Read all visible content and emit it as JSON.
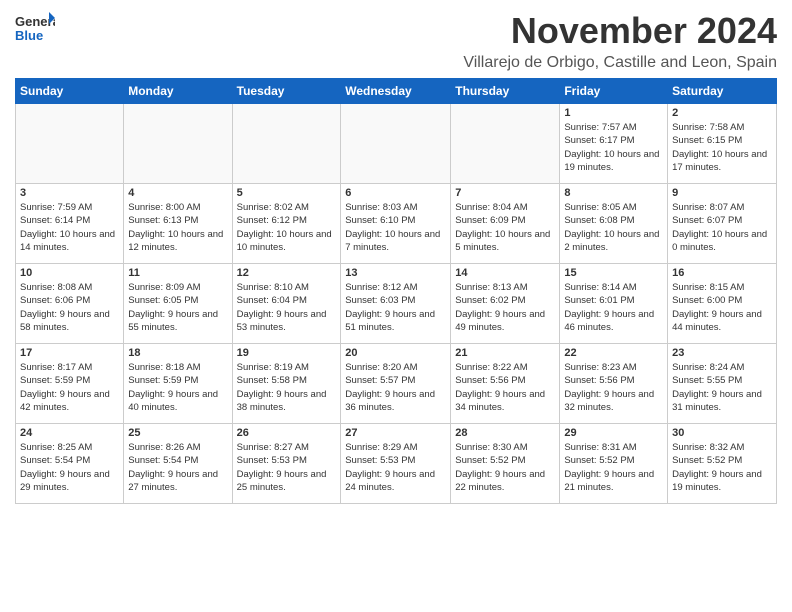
{
  "header": {
    "logo_general": "General",
    "logo_blue": "Blue",
    "month_title": "November 2024",
    "location": "Villarejo de Orbigo, Castille and Leon, Spain"
  },
  "weekdays": [
    "Sunday",
    "Monday",
    "Tuesday",
    "Wednesday",
    "Thursday",
    "Friday",
    "Saturday"
  ],
  "weeks": [
    [
      {
        "day": "",
        "info": ""
      },
      {
        "day": "",
        "info": ""
      },
      {
        "day": "",
        "info": ""
      },
      {
        "day": "",
        "info": ""
      },
      {
        "day": "",
        "info": ""
      },
      {
        "day": "1",
        "info": "Sunrise: 7:57 AM\nSunset: 6:17 PM\nDaylight: 10 hours and 19 minutes."
      },
      {
        "day": "2",
        "info": "Sunrise: 7:58 AM\nSunset: 6:15 PM\nDaylight: 10 hours and 17 minutes."
      }
    ],
    [
      {
        "day": "3",
        "info": "Sunrise: 7:59 AM\nSunset: 6:14 PM\nDaylight: 10 hours and 14 minutes."
      },
      {
        "day": "4",
        "info": "Sunrise: 8:00 AM\nSunset: 6:13 PM\nDaylight: 10 hours and 12 minutes."
      },
      {
        "day": "5",
        "info": "Sunrise: 8:02 AM\nSunset: 6:12 PM\nDaylight: 10 hours and 10 minutes."
      },
      {
        "day": "6",
        "info": "Sunrise: 8:03 AM\nSunset: 6:10 PM\nDaylight: 10 hours and 7 minutes."
      },
      {
        "day": "7",
        "info": "Sunrise: 8:04 AM\nSunset: 6:09 PM\nDaylight: 10 hours and 5 minutes."
      },
      {
        "day": "8",
        "info": "Sunrise: 8:05 AM\nSunset: 6:08 PM\nDaylight: 10 hours and 2 minutes."
      },
      {
        "day": "9",
        "info": "Sunrise: 8:07 AM\nSunset: 6:07 PM\nDaylight: 10 hours and 0 minutes."
      }
    ],
    [
      {
        "day": "10",
        "info": "Sunrise: 8:08 AM\nSunset: 6:06 PM\nDaylight: 9 hours and 58 minutes."
      },
      {
        "day": "11",
        "info": "Sunrise: 8:09 AM\nSunset: 6:05 PM\nDaylight: 9 hours and 55 minutes."
      },
      {
        "day": "12",
        "info": "Sunrise: 8:10 AM\nSunset: 6:04 PM\nDaylight: 9 hours and 53 minutes."
      },
      {
        "day": "13",
        "info": "Sunrise: 8:12 AM\nSunset: 6:03 PM\nDaylight: 9 hours and 51 minutes."
      },
      {
        "day": "14",
        "info": "Sunrise: 8:13 AM\nSunset: 6:02 PM\nDaylight: 9 hours and 49 minutes."
      },
      {
        "day": "15",
        "info": "Sunrise: 8:14 AM\nSunset: 6:01 PM\nDaylight: 9 hours and 46 minutes."
      },
      {
        "day": "16",
        "info": "Sunrise: 8:15 AM\nSunset: 6:00 PM\nDaylight: 9 hours and 44 minutes."
      }
    ],
    [
      {
        "day": "17",
        "info": "Sunrise: 8:17 AM\nSunset: 5:59 PM\nDaylight: 9 hours and 42 minutes."
      },
      {
        "day": "18",
        "info": "Sunrise: 8:18 AM\nSunset: 5:59 PM\nDaylight: 9 hours and 40 minutes."
      },
      {
        "day": "19",
        "info": "Sunrise: 8:19 AM\nSunset: 5:58 PM\nDaylight: 9 hours and 38 minutes."
      },
      {
        "day": "20",
        "info": "Sunrise: 8:20 AM\nSunset: 5:57 PM\nDaylight: 9 hours and 36 minutes."
      },
      {
        "day": "21",
        "info": "Sunrise: 8:22 AM\nSunset: 5:56 PM\nDaylight: 9 hours and 34 minutes."
      },
      {
        "day": "22",
        "info": "Sunrise: 8:23 AM\nSunset: 5:56 PM\nDaylight: 9 hours and 32 minutes."
      },
      {
        "day": "23",
        "info": "Sunrise: 8:24 AM\nSunset: 5:55 PM\nDaylight: 9 hours and 31 minutes."
      }
    ],
    [
      {
        "day": "24",
        "info": "Sunrise: 8:25 AM\nSunset: 5:54 PM\nDaylight: 9 hours and 29 minutes."
      },
      {
        "day": "25",
        "info": "Sunrise: 8:26 AM\nSunset: 5:54 PM\nDaylight: 9 hours and 27 minutes."
      },
      {
        "day": "26",
        "info": "Sunrise: 8:27 AM\nSunset: 5:53 PM\nDaylight: 9 hours and 25 minutes."
      },
      {
        "day": "27",
        "info": "Sunrise: 8:29 AM\nSunset: 5:53 PM\nDaylight: 9 hours and 24 minutes."
      },
      {
        "day": "28",
        "info": "Sunrise: 8:30 AM\nSunset: 5:52 PM\nDaylight: 9 hours and 22 minutes."
      },
      {
        "day": "29",
        "info": "Sunrise: 8:31 AM\nSunset: 5:52 PM\nDaylight: 9 hours and 21 minutes."
      },
      {
        "day": "30",
        "info": "Sunrise: 8:32 AM\nSunset: 5:52 PM\nDaylight: 9 hours and 19 minutes."
      }
    ]
  ]
}
